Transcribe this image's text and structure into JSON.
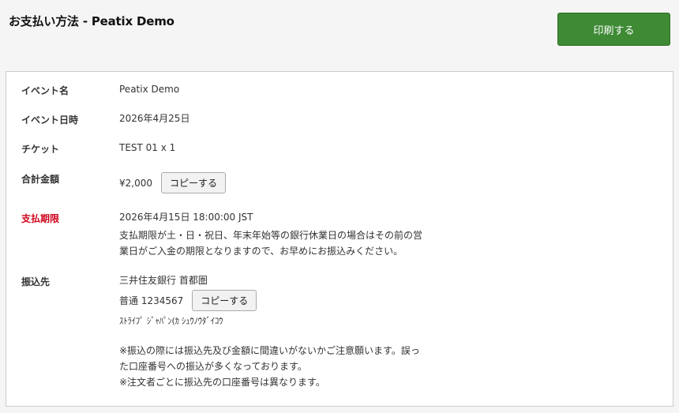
{
  "header": {
    "title": "お支払い方法 - Peatix Demo",
    "print_label": "印刷する"
  },
  "details": {
    "event_name": {
      "label": "イベント名",
      "value": "Peatix Demo"
    },
    "event_date": {
      "label": "イベント日時",
      "value": "2026年4月25日"
    },
    "ticket": {
      "label": "チケット",
      "value": "TEST 01 x 1"
    },
    "total": {
      "label": "合計金額",
      "value": "¥2,000",
      "copy_label": "コピーする"
    },
    "deadline": {
      "label": "支払期限",
      "value": "2026年4月15日 18:00:00 JST",
      "note_line1": "支払期限が土・日・祝日、年末年始等の銀行休業日の場合はその前の営",
      "note_line2": "業日がご入金の期限となりますので、お早めにお振込みください。"
    },
    "bank": {
      "label": "振込先",
      "bank_name": "三井住友銀行 首都圏",
      "account": "普通 1234567",
      "copy_label": "コピーする",
      "account_holder": "ｽﾄﾗｲﾌﾟ ｼﾞｬﾊﾟﾝ(ｶ ｼｭｳﾉｳﾀﾞｲｺｳ",
      "note_line1": "※振込の際には振込先及び金額に間違いがないかご注意願います。誤っ",
      "note_line2": "た口座番号への振込が多くなっております。",
      "note_line3": "※注文者ごとに振込先の口座番号は異なります。"
    }
  },
  "colors": {
    "print_button": "#3e8a35",
    "deadline_label": "#d0021b",
    "page_background": "#f5f5f5"
  }
}
